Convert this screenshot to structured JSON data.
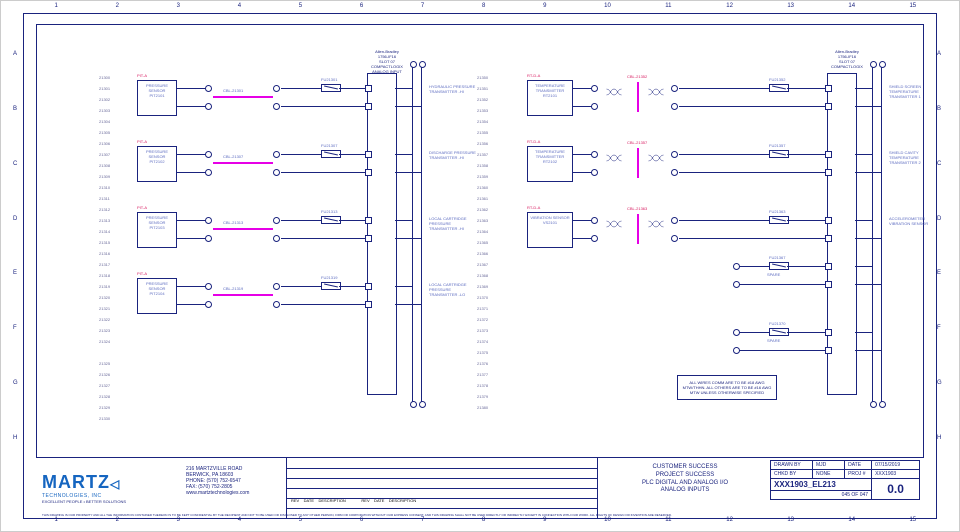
{
  "grid": {
    "cols": [
      "1",
      "2",
      "3",
      "4",
      "5",
      "6",
      "7",
      "8",
      "9",
      "10",
      "11",
      "12",
      "13",
      "14",
      "15"
    ],
    "rows": [
      "A",
      "B",
      "C",
      "D",
      "E",
      "F",
      "G",
      "H"
    ]
  },
  "linenumbers_left_primary": [
    "21300",
    "21301",
    "21302",
    "21303",
    "21304",
    "21305",
    "21306",
    "21307",
    "21308",
    "21309",
    "21310",
    "21311",
    "21312",
    "21313",
    "21314",
    "21315",
    "21316",
    "21317",
    "21318",
    "21319",
    "21320",
    "21321",
    "21322",
    "21323",
    "21324",
    "",
    "21325",
    "21326",
    "21327",
    "21328",
    "21329",
    "21330"
  ],
  "linenumbers_left_secondary": [
    "21350",
    "21351",
    "21352",
    "21353",
    "21354",
    "21355",
    "21356",
    "21357",
    "21358",
    "21359",
    "21360",
    "21361",
    "21362",
    "21363",
    "21364",
    "21365",
    "21366",
    "21367",
    "21368",
    "21369",
    "21370",
    "21371",
    "21372",
    "21373",
    "21374",
    "21375",
    "21376",
    "21377",
    "21378",
    "21379",
    "21380"
  ],
  "plc_left": {
    "header": [
      "Allen-Bradley",
      "1756-IF16",
      "SLOT 07",
      "COMPACTLOGIX",
      "ANALOG INPUT"
    ]
  },
  "plc_right": {
    "header": [
      "Allen-Bradley",
      "1756-IF16",
      "SLOT 07",
      "COMPACTLOGIX"
    ]
  },
  "sensors_left": [
    {
      "tag": "PIT-A",
      "name": "PRESSURE SENSOR",
      "id": "PIT2101",
      "cable": "CBL-21301",
      "fuse": "FU21301",
      "desc": "HYDRAULIC PRESSURE TRANSMITTER -HI"
    },
    {
      "tag": "PIT-A",
      "name": "PRESSURE SENSOR",
      "id": "PIT2102",
      "cable": "CBL-21307",
      "fuse": "FU21307",
      "desc": "DISCHARGE PRESSURE TRANSMITTER -HI"
    },
    {
      "tag": "PIT-A",
      "name": "PRESSURE SENSOR",
      "id": "PIT2103",
      "cable": "CBL-21313",
      "fuse": "FU21313",
      "desc": "LOCAL CARTRIDGE PRESSURE TRANSMITTER -HI"
    },
    {
      "tag": "PIT-A",
      "name": "PRESSURE SENSOR",
      "id": "PIT2104",
      "cable": "CBL-21319",
      "fuse": "FU21319",
      "desc": "LOCAL CARTRIDGE PRESSURE TRANSMITTER -LO"
    }
  ],
  "sensors_right": [
    {
      "tag": "RT-D-A",
      "name": "TEMPERATURE TRANSMITTER",
      "id": "RT2101",
      "cable": "CBL-21352",
      "fuse": "FU21352",
      "desc": "SHIELD SCREEN TEMPERATURE TRANSMITTER 1"
    },
    {
      "tag": "RT-D-A",
      "name": "TEMPERATURE TRANSMITTER",
      "id": "RT2102",
      "cable": "CBL-21357",
      "fuse": "FU21357",
      "desc": "SHIELD CAVITY TEMPERATURE TRANSMITTER 2"
    },
    {
      "tag": "RT-D-A",
      "name": "VIBRATION SENSOR",
      "id": "VS2101",
      "cable": "CBL-21363",
      "fuse": "FU21363",
      "desc": "ACCELEROMETER VIBRATION SENSOR"
    }
  ],
  "spares_right": [
    {
      "fuse": "FU21367",
      "label": "SPARE"
    },
    {
      "fuse": "FU21370",
      "label": "SPARE"
    }
  ],
  "note": "ALL WIRES COMM ARE TO BE #18 AWG MTW/THHN. ALL OTHERS ARE TO BE #16 AWG MTW UNLESS OTHERWISE SPECIFIED",
  "titleblock": {
    "company_main": "MARTZ",
    "company_sub": "TECHNOLOGIES, INC",
    "company_tag": "EXCELLENT PEOPLE • BETTER SOLUTIONS",
    "address": [
      "216 MARTZVILLE ROAD",
      "BERWICK, PA 18603",
      "PHONE: (570) 752-6547",
      "FAX: (570) 752-2805",
      "www.martztechnologies.com"
    ],
    "project": [
      "CUSTOMER SUCCESS",
      "PROJECT SUCCESS",
      "PLC DIGITAL AND ANALOG I/O",
      "ANALOG INPUTS"
    ],
    "drawn_by": "MJD",
    "date": "07/15/2019",
    "checked_by": "NONE",
    "project_no": "XXX1903",
    "drawing_no": "XXX1903_EL213",
    "sheet": "045 OF 047",
    "rev": "0.0",
    "disclaimer": "THIS DRAWING IS OUR PROPERTY AND ALL THE INFORMATION CONTAINED THEREON IS TO BE KEPT CONFIDENTIAL BY THE RECIPIENT AND NOT TO BE USED OR DISCLOSED TO ANY OTHER PERSON, FIRM OR CORPORATION WITHOUT OUR EXPRESS CONSENT, AND THIS DRAWING SHALL NOT BE USED DIRECTLY OR INDIRECTLY EXCEPT IN CONNECTION WITH OUR WORK. ALL RIGHTS OF DESIGN OR INVENTION ARE RESERVED."
  }
}
